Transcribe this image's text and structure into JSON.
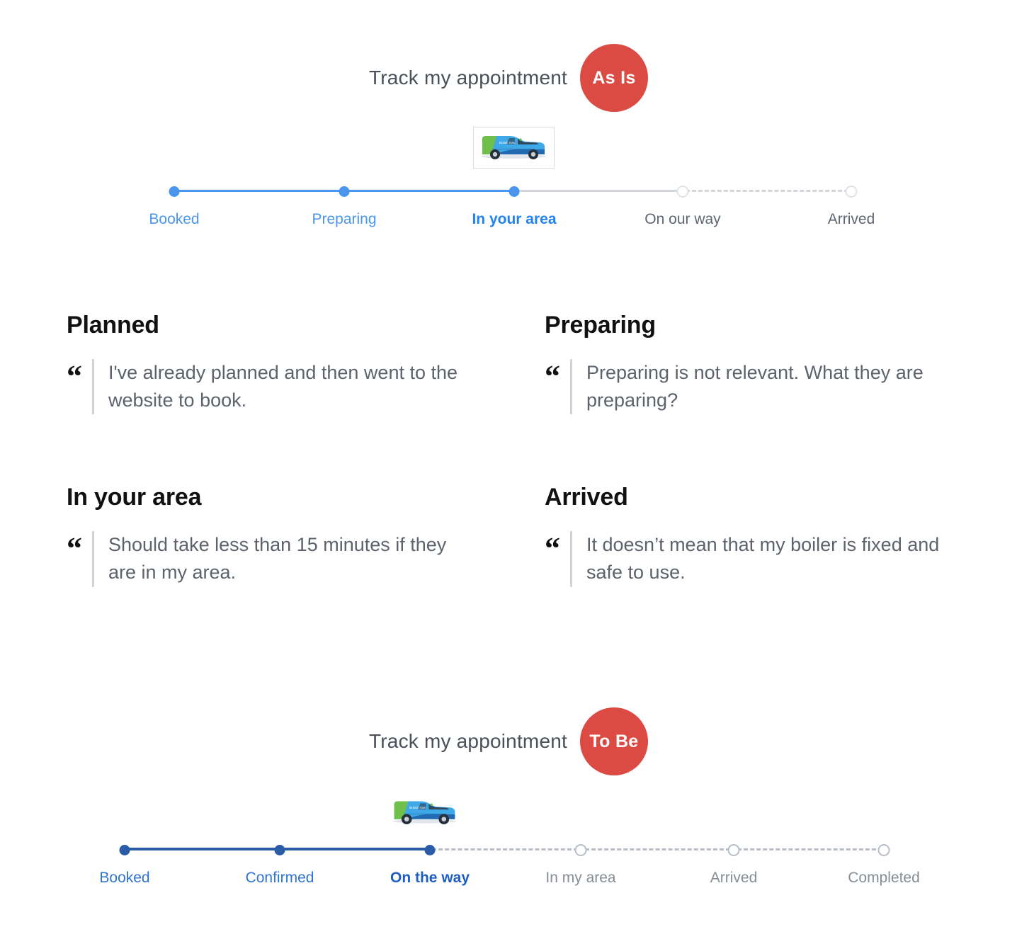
{
  "as_is": {
    "title": "Track my appointment",
    "badge": "As Is",
    "van_icon": "service-van-image",
    "steps": [
      {
        "label": "Booked",
        "state": "complete"
      },
      {
        "label": "Preparing",
        "state": "complete"
      },
      {
        "label": "In your area",
        "state": "current"
      },
      {
        "label": "On our way",
        "state": "upcoming"
      },
      {
        "label": "Arrived",
        "state": "upcoming"
      }
    ]
  },
  "to_be": {
    "title": "Track my appointment",
    "badge": "To Be",
    "van_icon": "service-van-image",
    "steps": [
      {
        "label": "Booked",
        "state": "complete"
      },
      {
        "label": "Confirmed",
        "state": "complete"
      },
      {
        "label": "On the way",
        "state": "current"
      },
      {
        "label": "In my area",
        "state": "upcoming"
      },
      {
        "label": "Arrived",
        "state": "upcoming"
      },
      {
        "label": "Completed",
        "state": "upcoming"
      }
    ]
  },
  "feedback": [
    {
      "heading": "Planned",
      "quote_mark": "“",
      "quote": "I've already planned and then went to the website to book."
    },
    {
      "heading": "Preparing",
      "quote_mark": "“",
      "quote": "Preparing is not relevant. What they are preparing?"
    },
    {
      "heading": "In your area",
      "quote_mark": "“",
      "quote": "Should take less than 15 minutes if they are in my area."
    },
    {
      "heading": "Arrived",
      "quote_mark": "“",
      "quote": "It doesn’t mean that my boiler is fixed and safe to use."
    }
  ],
  "colors": {
    "badge_red": "#dc4b43",
    "as_is_blue": "#4a95ee",
    "to_be_blue": "#2b5ca8",
    "muted_gray": "#d2d6da",
    "title_gray": "#4a5059",
    "quote_gray": "#5d636c"
  }
}
